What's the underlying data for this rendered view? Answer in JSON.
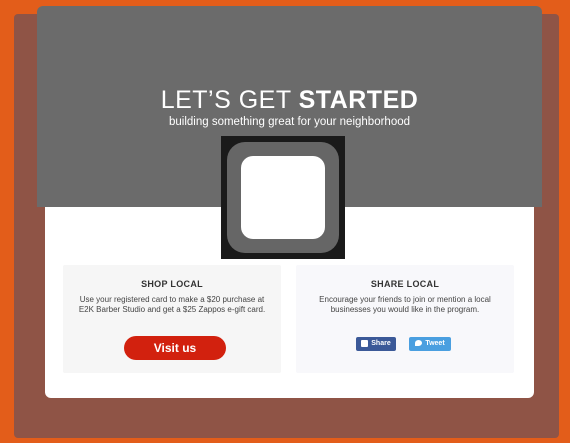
{
  "hero": {
    "title_light": "LET’S GET ",
    "title_bold": "STARTED",
    "subtitle": "building something great for your neighborhood"
  },
  "panels": {
    "shop": {
      "title": "SHOP LOCAL",
      "text": "Use your registered card to make a $20 purchase at E2K Barber Studio and get a $25 Zappos e-gift card.",
      "button_label": "Visit us"
    },
    "share": {
      "title": "SHARE LOCAL",
      "text": "Encourage your friends to join or mention a local businesses you would like in the program.",
      "facebook_label": "Share",
      "twitter_label": "Tweet"
    }
  },
  "colors": {
    "page_bg": "#e35d1a",
    "hero_bg": "#6b6b6b",
    "visit_button": "#d2210e",
    "facebook": "#3b5998",
    "twitter": "#4a9fe0"
  },
  "icons": {
    "logo": "placeholder-logo",
    "facebook": "facebook-icon",
    "twitter": "twitter-icon"
  }
}
